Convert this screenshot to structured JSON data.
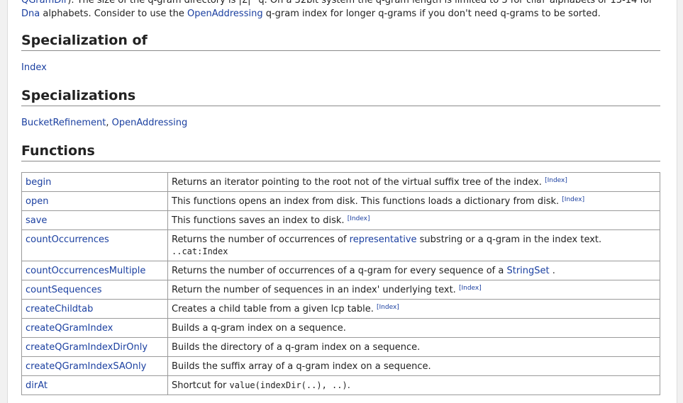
{
  "intro": {
    "line1_link": "QGramDir",
    "line1_text": "). The size of the q-gram directory is |Σ|^q. On a 32bit system the q-gram length is limited to 3 for",
    "line1_code": "char",
    "line1_end": "alphabets or 13-14 for",
    "line2_link1": "Dna",
    "line2_text1": "alphabets. Consider to use the",
    "line2_link2": "OpenAddressing",
    "line2_text2": "q-gram index for longer q-grams if you don't need q-grams to be sorted."
  },
  "specialization_of": {
    "heading": "Specialization of",
    "link": "Index"
  },
  "specializations": {
    "heading": "Specializations",
    "link1": "BucketRefinement",
    "sep": ",",
    "link2": "OpenAddressing"
  },
  "functions": {
    "heading": "Functions",
    "rows": [
      {
        "name": "begin",
        "desc": "Returns an iterator pointing to the root not of the virtual suffix tree of the index.",
        "tag": "[Index]"
      },
      {
        "name": "open",
        "desc": "This functions opens an index from disk. This functions loads a dictionary from disk.",
        "tag": "[Index]"
      },
      {
        "name": "save",
        "desc": "This functions saves an index to disk.",
        "tag": "[Index]"
      },
      {
        "name": "countOccurrences",
        "desc_a": "Returns the number of occurrences of",
        "desc_link": "representative",
        "desc_b": "substring or a q-gram in the index text.",
        "desc_code": "..cat:Index"
      },
      {
        "name": "countOccurrencesMultiple",
        "desc_a": "Returns the number of occurrences of a q-gram for every sequence of a",
        "desc_link": "StringSet",
        "desc_b": "."
      },
      {
        "name": "countSequences",
        "desc": "Return the number of sequences in an index' underlying text.",
        "tag": "[Index]"
      },
      {
        "name": "createChildtab",
        "desc": "Creates a child table from a given lcp table.",
        "tag": "[Index]"
      },
      {
        "name": "createQGramIndex",
        "desc": "Builds a q-gram index on a sequence."
      },
      {
        "name": "createQGramIndexDirOnly",
        "desc": "Builds the directory of a q-gram index on a sequence."
      },
      {
        "name": "createQGramIndexSAOnly",
        "desc": "Builds the suffix array of a q-gram index on a sequence."
      },
      {
        "name": "dirAt",
        "desc": "Shortcut for",
        "desc_code": "value(indexDir(..), ..)",
        "desc_end": "."
      }
    ]
  }
}
